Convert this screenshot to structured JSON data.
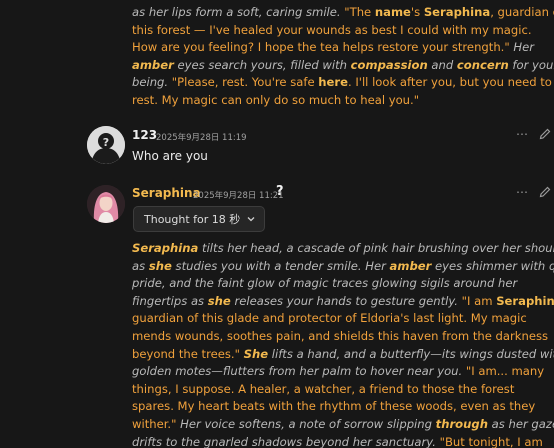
{
  "top_message": {
    "lines": [
      [
        [
          "it",
          "as her lips form a soft, caring smile. "
        ],
        [
          "q",
          "\"The "
        ],
        [
          "b",
          "name"
        ],
        [
          "q",
          "'s "
        ],
        [
          "b",
          "Seraphina"
        ],
        [
          "q",
          ", guardian of"
        ]
      ],
      [
        [
          "q",
          "this forest — I've healed your wounds as best I could with my magic."
        ]
      ],
      [
        [
          "q",
          "How are you feeling? I hope the tea helps restore your strength.\" "
        ],
        [
          "it",
          "Her"
        ]
      ],
      [
        [
          "bi",
          "amber"
        ],
        [
          "it",
          " eyes search yours, filled with "
        ],
        [
          "bi",
          "compassion"
        ],
        [
          "it",
          " and "
        ],
        [
          "bi",
          "concern"
        ],
        [
          "it",
          " for your well"
        ]
      ],
      [
        [
          "it",
          "being. "
        ],
        [
          "q",
          "\"Please, rest. You're safe "
        ],
        [
          "b",
          "here"
        ],
        [
          "q",
          ". I'll look after you, but you need to"
        ]
      ],
      [
        [
          "q",
          "rest. My magic can only do so much to heal you.\""
        ]
      ]
    ]
  },
  "user_message": {
    "name": "123",
    "timestamp": "2025年9月28日 11:19",
    "text": "Who are you"
  },
  "char_message": {
    "name": "Seraphina",
    "timestamp": "2025年9月28日 11:21",
    "help_icon_text": "?",
    "thought_label": "Thought for 18 秒",
    "lines": [
      [
        [
          "bi",
          "Seraphina"
        ],
        [
          "it",
          " tilts her head, a cascade of pink hair brushing over her shoulder"
        ]
      ],
      [
        [
          "it",
          "as "
        ],
        [
          "bi",
          "she"
        ],
        [
          "it",
          " studies you with a tender smile. Her "
        ],
        [
          "bi",
          "amber"
        ],
        [
          "it",
          " eyes shimmer with quiet"
        ]
      ],
      [
        [
          "it",
          "pride, and the faint glow of magic traces glowing sigils around her"
        ]
      ],
      [
        [
          "it",
          "fingertips as "
        ],
        [
          "bi",
          "she"
        ],
        [
          "it",
          " releases your hands to gesture gently. "
        ],
        [
          "q",
          "\"I am "
        ],
        [
          "b",
          "Seraphina"
        ],
        [
          "q",
          ","
        ]
      ],
      [
        [
          "q",
          "guardian of this glade and protector of Eldoria's last light. My magic"
        ]
      ],
      [
        [
          "q",
          "mends wounds, soothes pain, and shields this haven from the darkness"
        ]
      ],
      [
        [
          "q",
          "beyond the trees.\" "
        ],
        [
          "bi",
          "She"
        ],
        [
          "it",
          " lifts a hand, and a butterfly—its wings dusted with"
        ]
      ],
      [
        [
          "it",
          "golden motes—flutters from her palm to hover near you. "
        ],
        [
          "q",
          "\"I am... many"
        ]
      ],
      [
        [
          "q",
          "things, I suppose. A healer, a watcher, a friend to those the forest"
        ]
      ],
      [
        [
          "q",
          "spares. My heart beats with the rhythm of these woods, even as they"
        ]
      ],
      [
        [
          "q",
          "wither.\" "
        ],
        [
          "it",
          "Her voice softens, a note of sorrow slipping "
        ],
        [
          "bi",
          "through"
        ],
        [
          "it",
          " as her gaze"
        ]
      ],
      [
        [
          "it",
          "drifts to the gnarled shadows beyond her sanctuary. "
        ],
        [
          "q",
          "\"But tonight, I am"
        ]
      ]
    ]
  },
  "actions": {
    "more_icon": "⋯",
    "edit_icon": "pencil-icon"
  },
  "colors": {
    "quote": "#f0a13c",
    "bold_name": "#f2b94f",
    "italic": "#b9b9b9",
    "background": "#171717"
  }
}
